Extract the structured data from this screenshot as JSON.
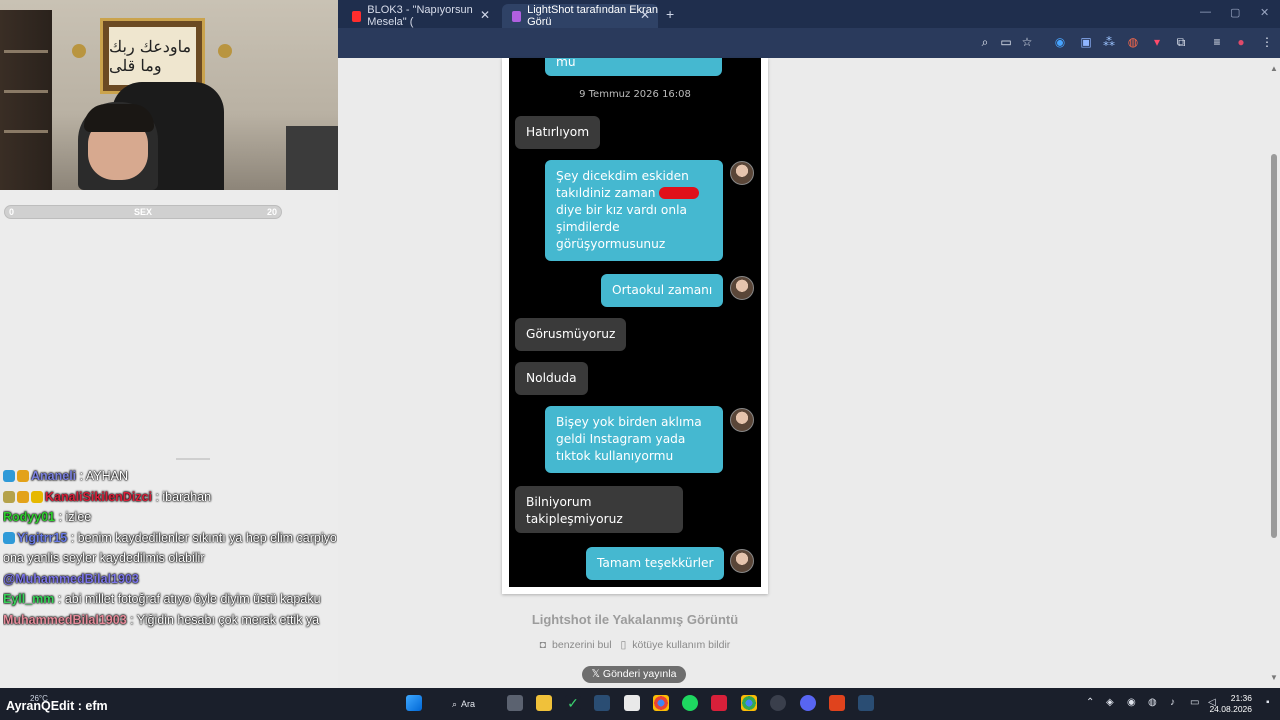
{
  "webcam": {
    "frame_text": "ماودعك ربك وما قلى"
  },
  "progress": {
    "min": "0",
    "label": "SEX",
    "max": "20",
    "fraction": 0.0
  },
  "chat": [
    {
      "user": "Ananeli",
      "user_color": "#7c82e0",
      "badges": [
        "#2f9ad8",
        "#e3a21a"
      ],
      "text": " : AYHAN"
    },
    {
      "user": "KanaliSikilenDizci",
      "user_color": "#d8203a",
      "badges": [
        "#b5a24b",
        "#e3a21a",
        "#e6b800"
      ],
      "text": " : ibarahan"
    },
    {
      "user": "Rodyy01",
      "user_color": "#2fcf2f",
      "badges": [],
      "text": " : izlee"
    },
    {
      "user": "Yigitrr15",
      "user_color": "#6a7ce6",
      "badges": [
        "#2f9ad8"
      ],
      "text": " : benim kaydedilenler sıkıntı ya hep elim carpiyo ona yanlis seyler kaydedilmis olabilir",
      "mention": "@MuhammedBilal1903"
    },
    {
      "user": "Eyll_mm",
      "user_color": "#38d25a",
      "badges": [],
      "text": " : abi millet fotoğraf atıyo öyle diyim üstü kapaku"
    },
    {
      "user": "MuhammedBilal1903",
      "user_color": "#e58b9a",
      "badges": [],
      "text": " : Yiğidin hesabı çok merak ettik ya"
    }
  ],
  "browser": {
    "tabs": [
      {
        "label": "BLOK3 - \"Napıyorsun Mesela\" (",
        "favicon_color": "#ff2d2d",
        "active": false
      },
      {
        "label": "LightShot tarafından Ekran Görü",
        "favicon_color": "#b060e0",
        "active": true
      }
    ],
    "new_tab": "+",
    "window_controls": [
      "—",
      "▢",
      "✕"
    ],
    "toolbar_icons": [
      "zoom-icon",
      "cast-icon",
      "star-icon",
      "extension-a-icon",
      "extension-b-icon",
      "translate-icon",
      "extension-c-icon",
      "extension-d-icon",
      "extensions-icon",
      "reading-list-icon",
      "profile-icon",
      "menu-icon"
    ]
  },
  "conversation": {
    "top_fragment": "mu",
    "timestamp": "9 Temmuz 2026 16:08",
    "messages": [
      {
        "dir": "in",
        "text": "Hatırlıyom"
      },
      {
        "dir": "out",
        "line1": "Şey dicekdim eskiden",
        "line2": "takıldiniz zaman",
        "line3": "diye bir kız vardı onla",
        "line4": "şimdilerde",
        "line5": "görüşyormusunuz"
      },
      {
        "dir": "out",
        "text": "Ortaokul zamanı"
      },
      {
        "dir": "in",
        "text": "Görusmüyoruz"
      },
      {
        "dir": "in",
        "text": "Nolduda"
      },
      {
        "dir": "out",
        "line1": "Bişey yok birden aklıma",
        "line2": "geldi Instagram yada",
        "line3": "tıktok kullanıyormu"
      },
      {
        "dir": "in",
        "line1": "Bilniyorum",
        "line2": "takipleşmiyoruz"
      },
      {
        "dir": "out",
        "text": "Tamam teşekkürler"
      }
    ]
  },
  "lightshot": {
    "caption": "Lightshot ile Yakalanmış Görüntü",
    "similar_link": "benzerini bul",
    "report_link": "kötüye kullanım bildir",
    "post_button": "𝕏 Gönderi yayınla"
  },
  "taskbar": {
    "weather": "26°C",
    "ticker": "AyranQEdit : efm",
    "search_label": "Ara",
    "time": "21:36",
    "date": "24.08.2026"
  }
}
